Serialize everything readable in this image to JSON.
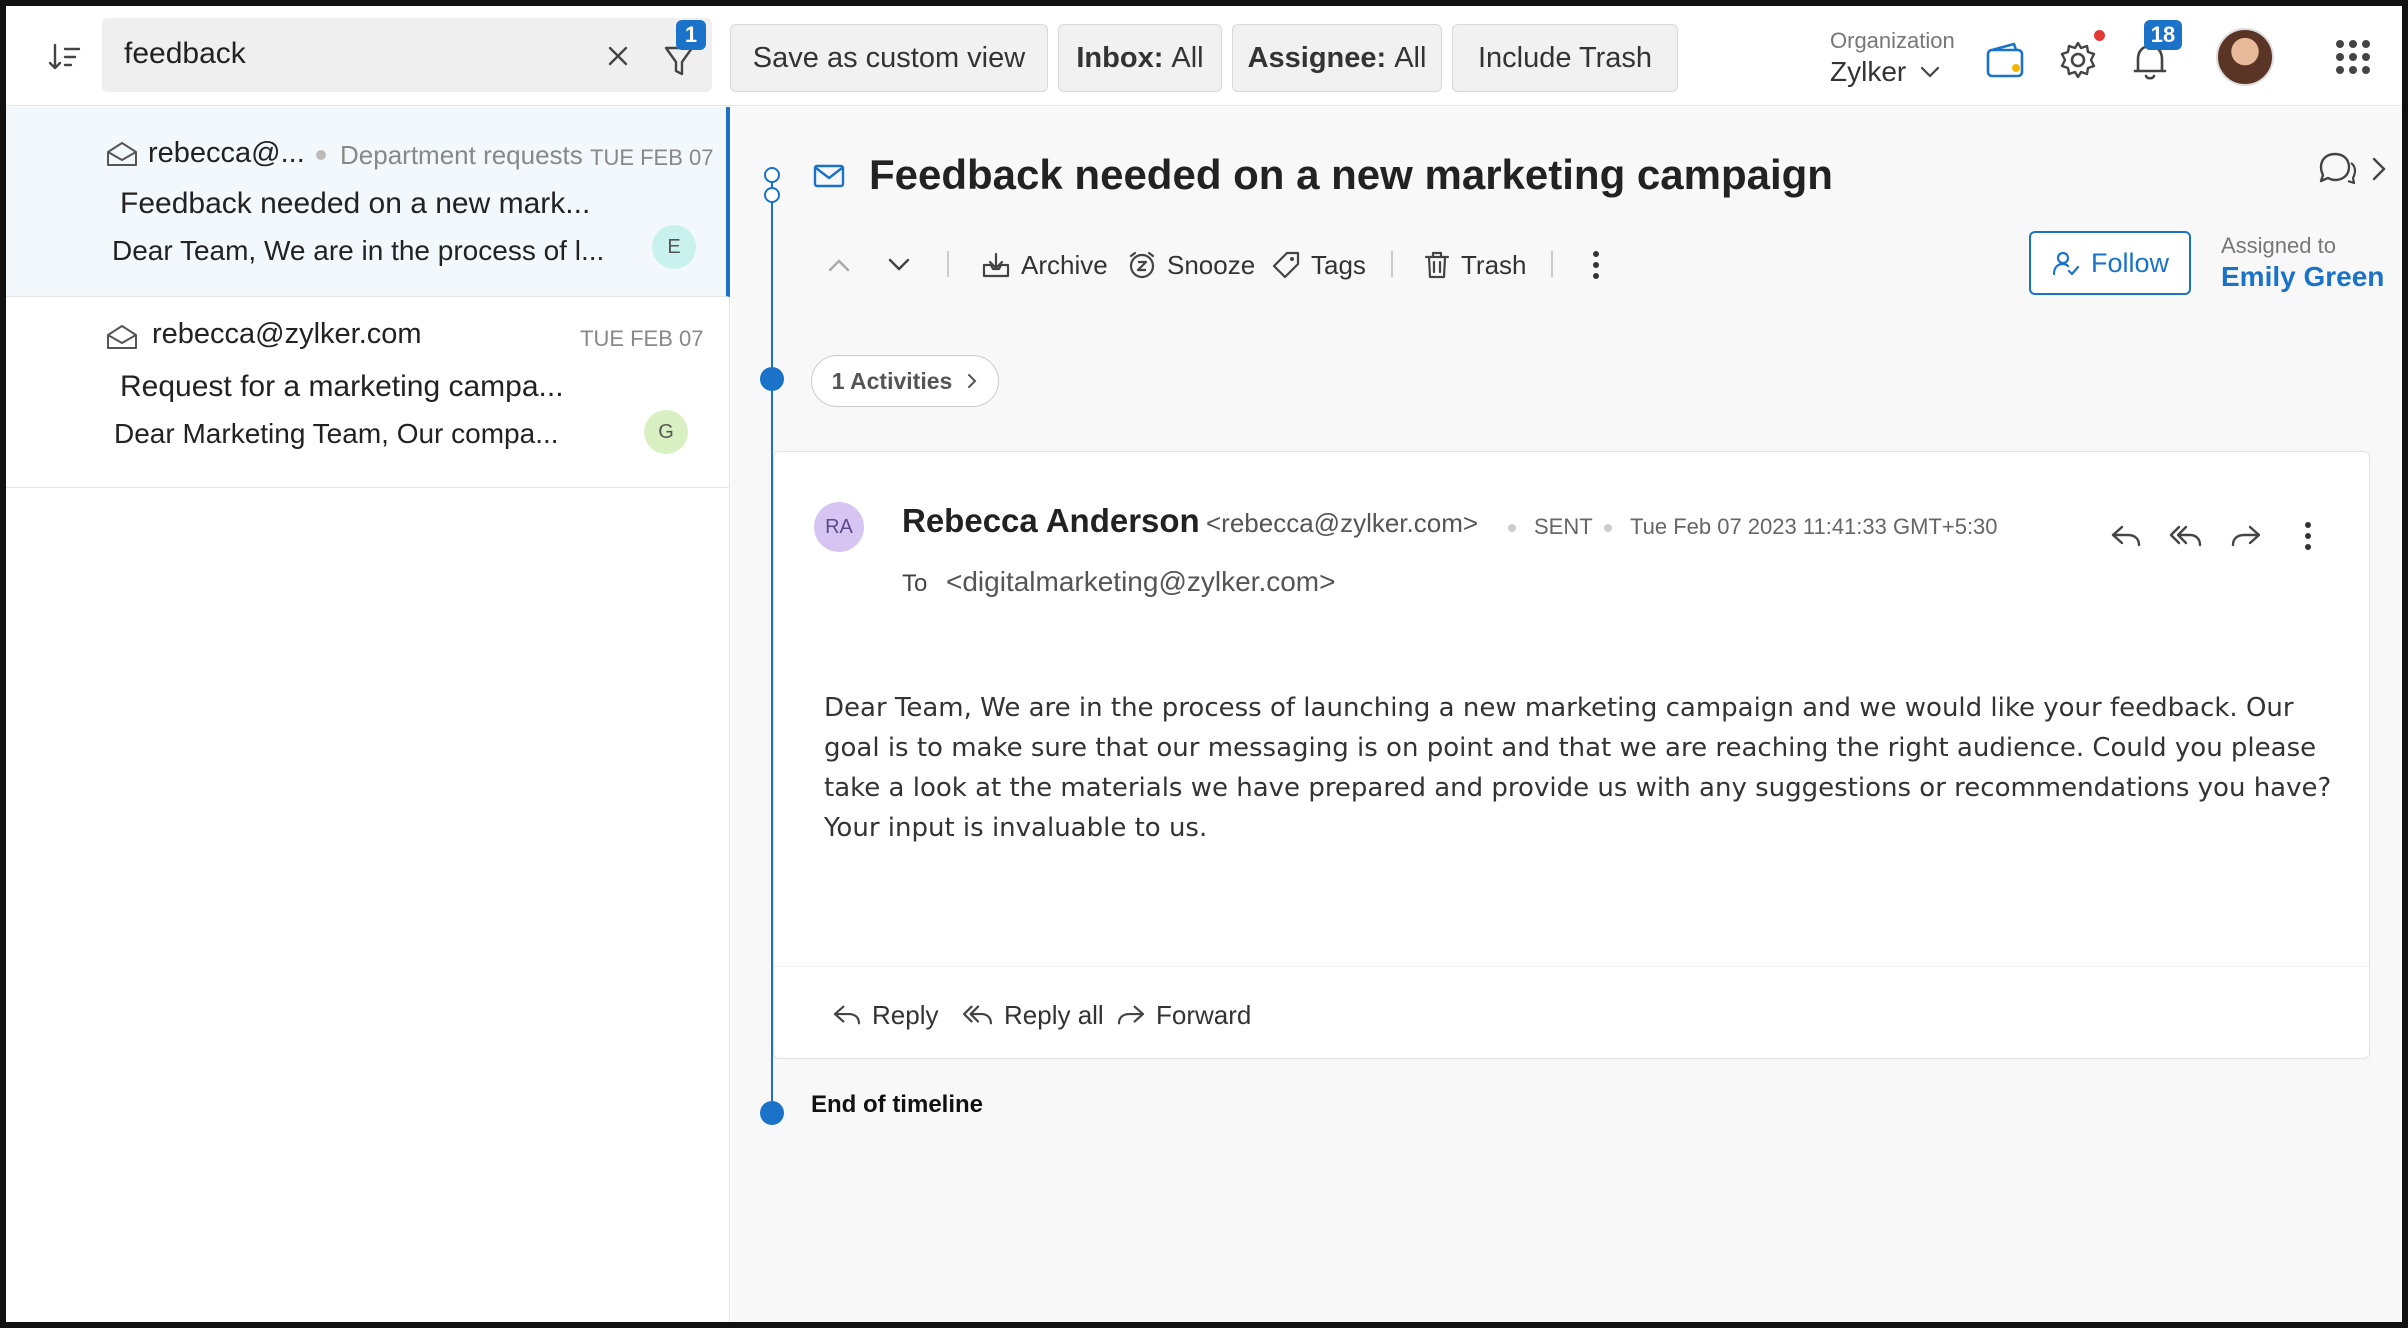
{
  "search": {
    "value": "feedback",
    "filter_count": "1"
  },
  "chips": {
    "save_view": "Save as custom view",
    "inbox_label": "Inbox:",
    "inbox_value": "All",
    "assignee_label": "Assignee:",
    "assignee_value": "All",
    "include_trash": "Include Trash"
  },
  "org": {
    "label": "Organization",
    "name": "Zylker"
  },
  "notifications": {
    "count": "18"
  },
  "tickets": [
    {
      "from": "rebecca@...",
      "department": "Department requests",
      "date": "TUE FEB 07",
      "subject": "Feedback needed on a new mark...",
      "snippet": "Dear Team, We are in the process of l...",
      "avatar": "E",
      "avatar_color": "#c9f1ee"
    },
    {
      "from": "rebecca@zylker.com",
      "date": "TUE FEB 07",
      "subject": "Request for a marketing campa...",
      "snippet": "Dear Marketing Team, Our compa...",
      "avatar": "G",
      "avatar_color": "#d8f0c2"
    }
  ],
  "detail": {
    "subject": "Feedback needed on a new marketing campaign",
    "toolbar": {
      "archive": "Archive",
      "snooze": "Snooze",
      "tags": "Tags",
      "trash": "Trash"
    },
    "follow": "Follow",
    "assigned_label": "Assigned to",
    "assigned_name": "Emily Green",
    "activities": "1 Activities",
    "mail": {
      "initials": "RA",
      "from_name": "Rebecca Anderson",
      "from_email": "<rebecca@zylker.com>",
      "status": "SENT",
      "timestamp": "Tue Feb 07 2023 11:41:33 GMT+5:30",
      "to_label": "To",
      "to": "<digitalmarketing@zylker.com>",
      "body": "Dear Team, We are in the process of launching a new marketing campaign and we would like your feedback. Our goal is to make sure that our messaging is on point and that we are reaching the right audience. Could you please take a look at the materials we have prepared and provide us with any suggestions or recommendations you have? Your input is invaluable to us."
    },
    "footer": {
      "reply": "Reply",
      "reply_all": "Reply all",
      "forward": "Forward"
    },
    "end_of_timeline": "End of timeline"
  },
  "colors": {
    "accent": "#1a73c8",
    "active_row": "#f3f8fd"
  }
}
